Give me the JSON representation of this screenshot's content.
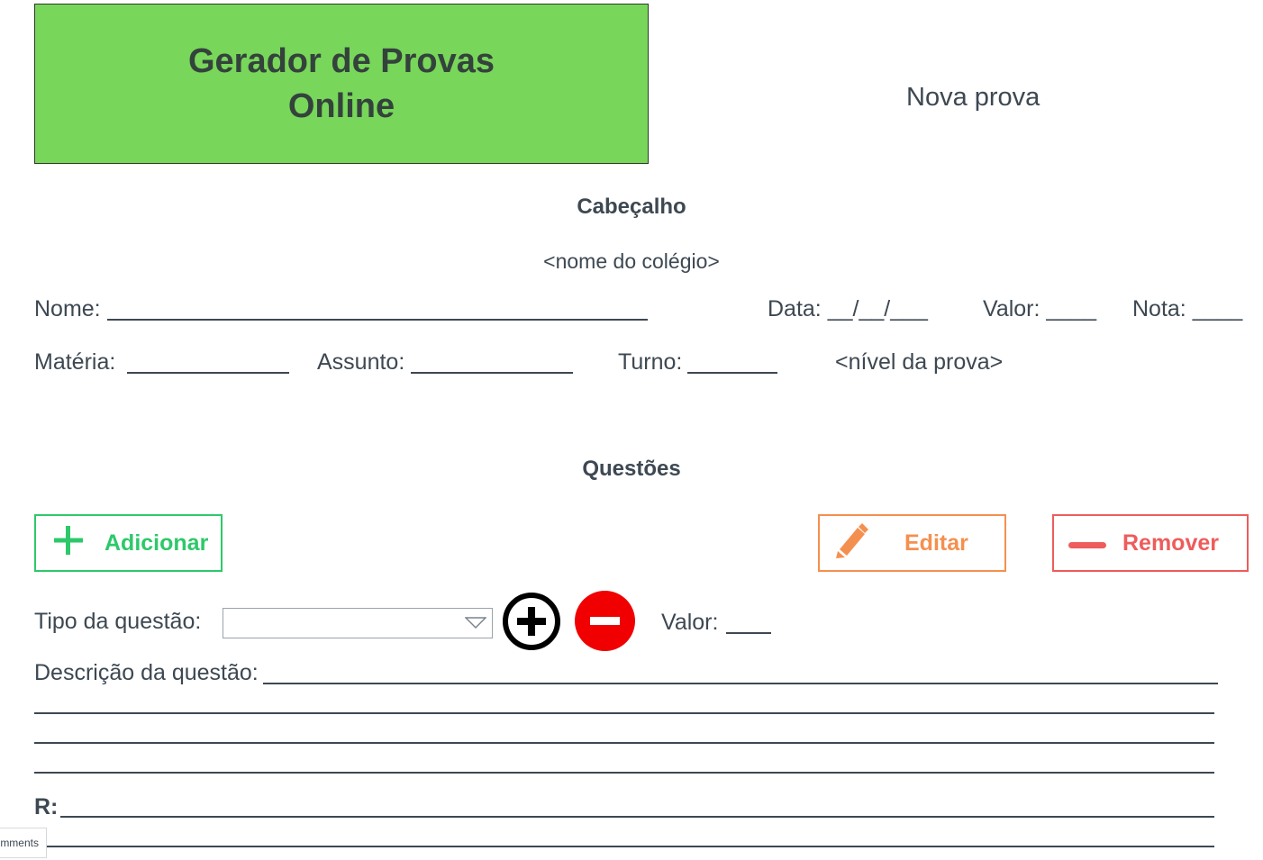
{
  "header": {
    "app_title": "Gerador de Provas Online",
    "page_title": "Nova prova"
  },
  "cabecalho": {
    "section_title": "Cabeçalho",
    "school_placeholder": "<nome do colégio>",
    "name_label": "Nome:",
    "date_label": "Data: __/__/___",
    "value_label": "Valor: ____",
    "grade_label": "Nota: ____",
    "subject_label": "Matéria:",
    "topic_label": "Assunto:",
    "shift_label": "Turno:",
    "level_placeholder": "<nível da prova>"
  },
  "questoes": {
    "section_title": "Questões",
    "add_button": "Adicionar",
    "edit_button": "Editar",
    "remove_button": "Remover",
    "type_label": "Tipo da questão:",
    "type_select_value": "",
    "question_value_label": "Valor:",
    "description_label": "Descrição da questão:",
    "answer_label": "R:"
  },
  "comments_tab": "mments",
  "colors": {
    "title_bg": "#78d65a",
    "add": "#2ec86a",
    "edit": "#f4904f",
    "remove": "#ee5c5c",
    "minus_circle": "#f00000",
    "text": "#3d4852"
  }
}
